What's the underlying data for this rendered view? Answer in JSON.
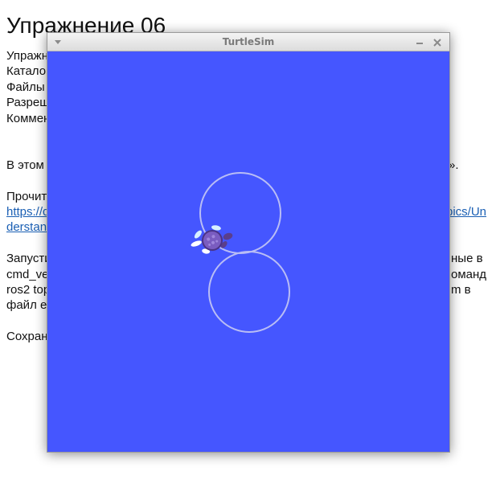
{
  "document": {
    "title": "Упражнение 06",
    "left_fragments": [
      "Упражн",
      "Катало",
      "Файлы",
      "Разреш",
      "Коммен"
    ],
    "para1_left": "В этом",
    "para1_right": "».",
    "para2_left": "Прочит",
    "link_line1_left": "https://d",
    "link_line1_right": "pics/Un",
    "link_line2_left": "derstand",
    "para3_line1_left": "Запусти",
    "para3_line1_right": "ные в",
    "para3_line2_left": "cmd_ve",
    "para3_line2_right": "оманд",
    "para3_line3_left": "ros2 top",
    "para3_line3_right": "m в",
    "para3_line4_left": "файл e",
    "para4_left": "Сохран"
  },
  "window": {
    "title": "TurtleSim",
    "icons": [
      "menu-arrow-icon",
      "minimize-icon",
      "close-icon"
    ],
    "background_color": "#4556ff",
    "path_color": "#b9bdf5",
    "turtle_color": "#7a5cc0"
  }
}
